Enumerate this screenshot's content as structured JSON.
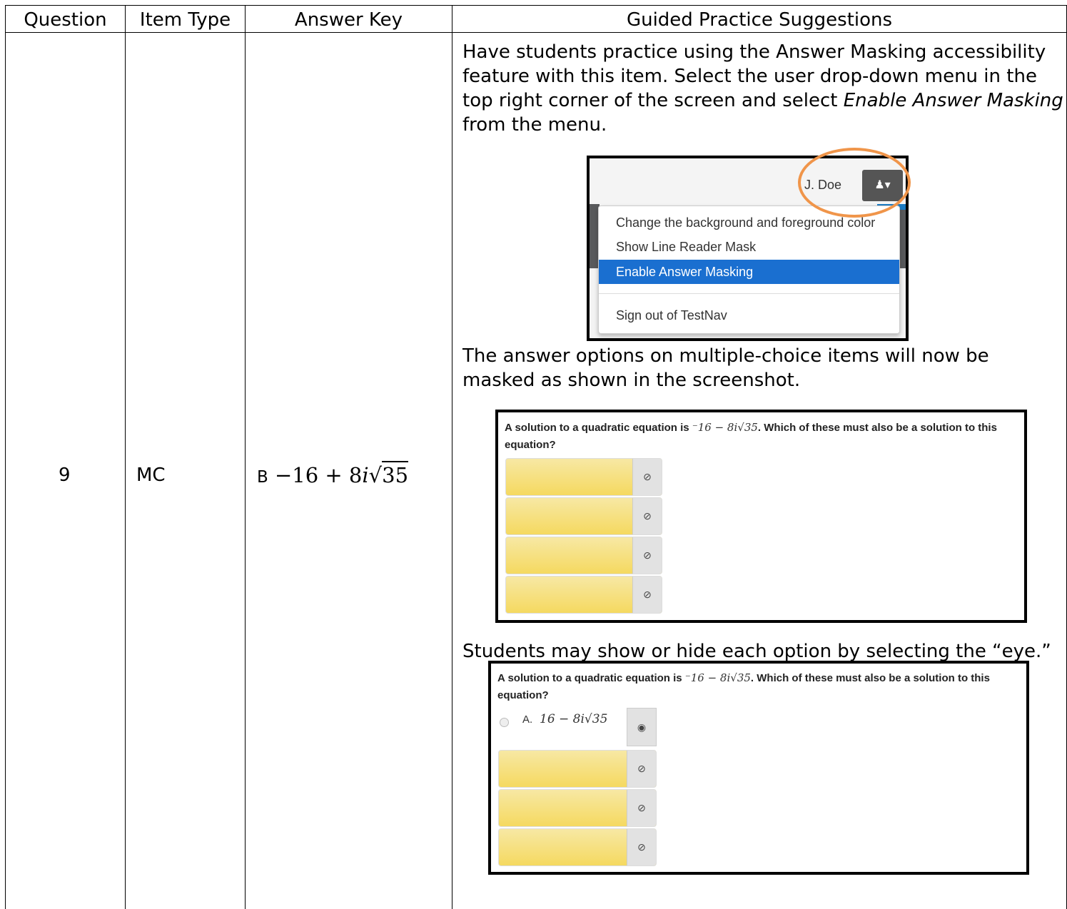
{
  "headers": [
    "Question",
    "Item Type",
    "Answer Key",
    "Guided Practice Suggestions"
  ],
  "row": {
    "question": "9",
    "item_type": "MC",
    "answer_letter": "B",
    "answer_expr_prefix": "−16 + 8",
    "answer_expr_i": "i",
    "answer_expr_radicand": "35"
  },
  "guidance": {
    "p1_start": "Have students practice using the Answer Masking accessibility feature with this item.  Select the user drop-down menu in the top right corner of the screen and select ",
    "p1_em": "Enable Answer Masking",
    "p1_end": " from the menu.",
    "p2": "The answer options on multiple-choice items will now be masked as shown in the screenshot.",
    "p3": "Students may show or hide each option by selecting the “eye.”"
  },
  "menu_screenshot": {
    "user_name": "J. Doe",
    "items": [
      "Change the background and foreground color",
      "Show Line Reader Mask",
      "Enable Answer Masking",
      "Sign out of TestNav"
    ],
    "active_item": "Enable Answer Masking"
  },
  "question_screenshot": {
    "stem_start": "A solution to a quadratic equation is",
    "stem_math": "⁻16 − 8i√35",
    "stem_end": ". Which of these must also be a solution to this",
    "stem_line2": "equation?",
    "eye_hidden_icon": "eye-slash-icon",
    "eye_shown_icon": "eye-icon"
  },
  "shown_option": {
    "letter": "A.",
    "math": "16 − 8i√35"
  },
  "colors": {
    "highlight_ring": "#f0954a",
    "menu_active": "#1a6fd0",
    "mask_fill": "#f5d960"
  }
}
